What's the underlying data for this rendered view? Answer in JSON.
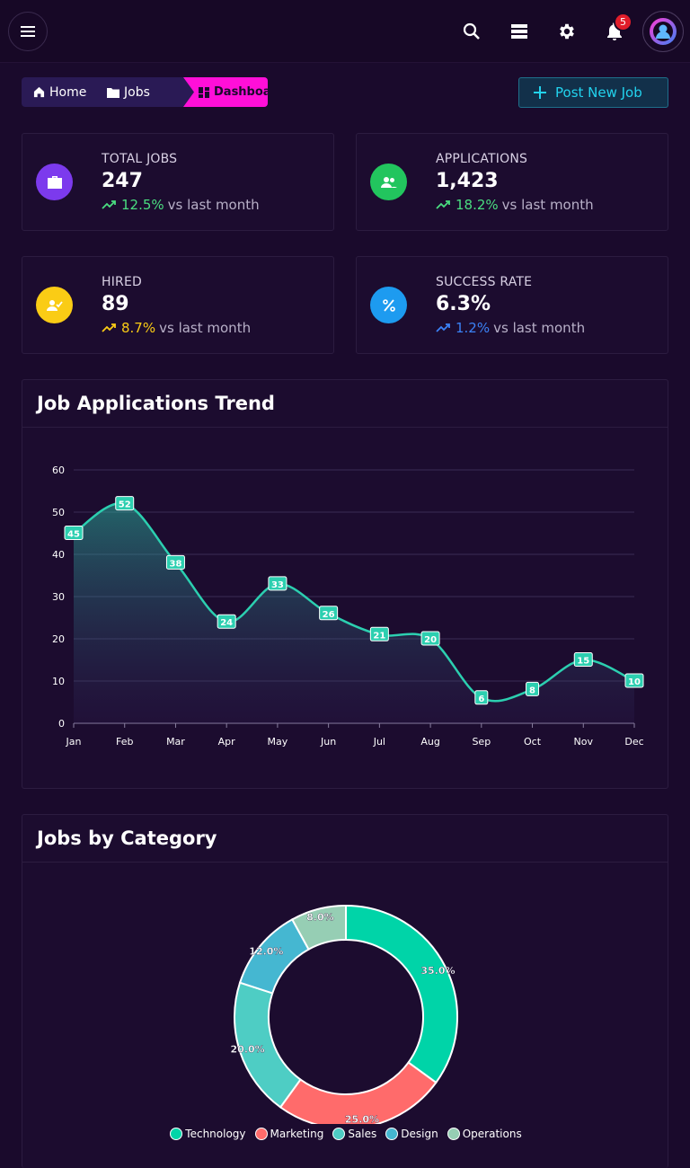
{
  "header": {
    "notification_count": "5"
  },
  "breadcrumb": {
    "home": "Home",
    "jobs": "Jobs",
    "current": "Dashboard"
  },
  "actions": {
    "post_job": "Post New Job"
  },
  "stats": [
    {
      "label": "TOTAL JOBS",
      "value": "247",
      "change": "12.5%",
      "suffix": "vs last month",
      "color": "#7c3aed",
      "trend_color": "#4ade80",
      "icon": "briefcase-icon"
    },
    {
      "label": "APPLICATIONS",
      "value": "1,423",
      "change": "18.2%",
      "suffix": "vs last month",
      "color": "#22c55e",
      "trend_color": "#4ade80",
      "icon": "users-icon"
    },
    {
      "label": "HIRED",
      "value": "89",
      "change": "8.7%",
      "suffix": "vs last month",
      "color": "#facc15",
      "trend_color": "#facc15",
      "icon": "user-check-icon"
    },
    {
      "label": "SUCCESS RATE",
      "value": "6.3%",
      "change": "1.2%",
      "suffix": "vs last month",
      "color": "#1d9bf0",
      "trend_color": "#3b82f6",
      "icon": "percent-icon"
    }
  ],
  "trend_panel": {
    "title": "Job Applications Trend"
  },
  "category_panel": {
    "title": "Jobs by Category"
  },
  "chart_data": [
    {
      "type": "area",
      "categories": [
        "Jan",
        "Feb",
        "Mar",
        "Apr",
        "May",
        "Jun",
        "Jul",
        "Aug",
        "Sep",
        "Oct",
        "Nov",
        "Dec"
      ],
      "values": [
        45,
        52,
        38,
        24,
        33,
        26,
        21,
        20,
        6,
        8,
        15,
        10
      ],
      "ylim": [
        0,
        60
      ],
      "yticks": [
        0,
        10,
        20,
        30,
        40,
        50,
        60
      ],
      "grid": true,
      "color": "#2ccfb0"
    },
    {
      "type": "pie",
      "categories": [
        "Technology",
        "Marketing",
        "Sales",
        "Design",
        "Operations"
      ],
      "values": [
        35.0,
        25.0,
        20.0,
        12.0,
        8.0
      ],
      "labels": [
        "35.0%",
        "25.0%",
        "20.0%",
        "12.0%",
        "8.0%"
      ],
      "colors": [
        "#00d4a8",
        "#ff6b6b",
        "#4ecdc4",
        "#45b7d1",
        "#96ceb4"
      ],
      "legend_position": "bottom"
    }
  ]
}
